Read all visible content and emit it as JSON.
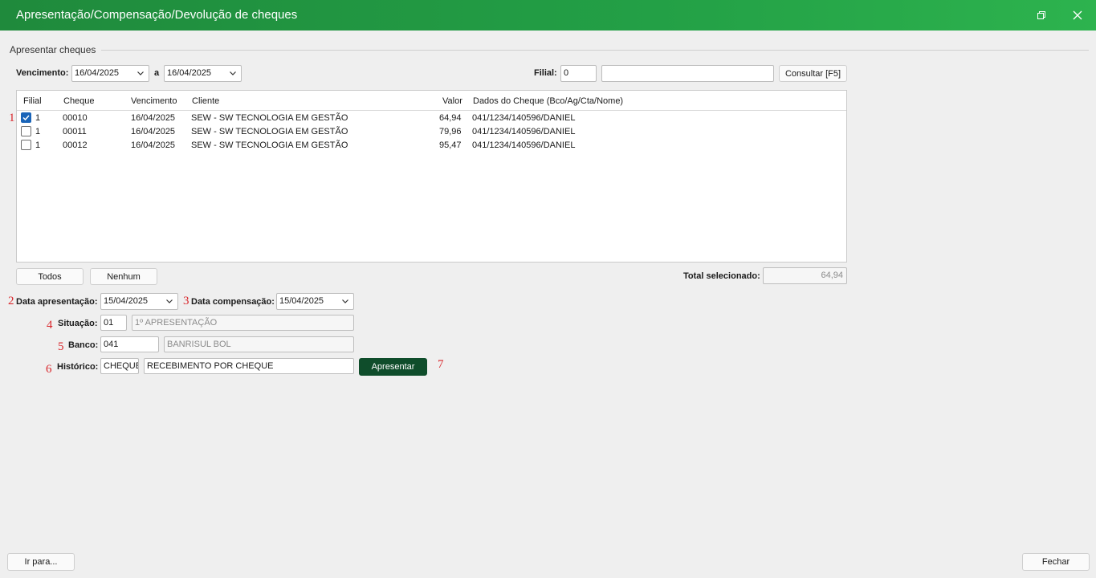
{
  "window": {
    "title": "Apresentação/Compensação/Devolução de cheques"
  },
  "section": {
    "legend": "Apresentar cheques"
  },
  "filter": {
    "vencimento_label": "Vencimento:",
    "date_from": "16/04/2025",
    "a_label": "a",
    "date_to": "16/04/2025",
    "filial_label": "Filial:",
    "filial_value": "0",
    "filial_name": "",
    "consultar_label": "Consultar [F5]"
  },
  "grid": {
    "columns": [
      "Filial",
      "Cheque",
      "Vencimento",
      "Cliente",
      "Valor",
      "Dados do Cheque (Bco/Ag/Cta/Nome)"
    ],
    "rows": [
      {
        "checked": true,
        "filial": "1",
        "cheque": "00010",
        "vencimento": "16/04/2025",
        "cliente": "SEW - SW TECNOLOGIA EM GESTÃO",
        "valor": "64,94",
        "dados": "041/1234/140596/DANIEL"
      },
      {
        "checked": false,
        "filial": "1",
        "cheque": "00011",
        "vencimento": "16/04/2025",
        "cliente": "SEW - SW TECNOLOGIA EM GESTÃO",
        "valor": "79,96",
        "dados": "041/1234/140596/DANIEL"
      },
      {
        "checked": false,
        "filial": "1",
        "cheque": "00012",
        "vencimento": "16/04/2025",
        "cliente": "SEW - SW TECNOLOGIA EM GESTÃO",
        "valor": "95,47",
        "dados": "041/1234/140596/DANIEL"
      }
    ]
  },
  "selection": {
    "todos_label": "Todos",
    "nenhum_label": "Nenhum",
    "total_label": "Total selecionado:",
    "total_value": "64,94"
  },
  "form": {
    "data_apresentacao_label": "Data apresentação:",
    "data_apresentacao": "15/04/2025",
    "data_compensacao_label": "Data compensação:",
    "data_compensacao": "15/04/2025",
    "situacao_label": "Situação:",
    "situacao_code": "01",
    "situacao_desc": "1º APRESENTAÇÃO",
    "banco_label": "Banco:",
    "banco_code": "041",
    "banco_desc": "BANRISUL BOL",
    "historico_label": "Histórico:",
    "historico_code": "CHEQUE",
    "historico_desc": "RECEBIMENTO POR CHEQUE",
    "apresentar_label": "Apresentar"
  },
  "markers": [
    "1",
    "2",
    "3",
    "4",
    "5",
    "6",
    "7"
  ],
  "footer": {
    "ir_para_label": "Ir para...",
    "fechar_label": "Fechar"
  },
  "colors": {
    "title_green": "#23a046",
    "primary_button": "#0f4d2b",
    "marker_red": "#d9262b",
    "checkbox_blue": "#1a64b8"
  },
  "icons": {
    "restore": "restore-icon",
    "close": "close-icon",
    "dropdown": "chevron-down-icon",
    "check": "checkmark-icon"
  }
}
